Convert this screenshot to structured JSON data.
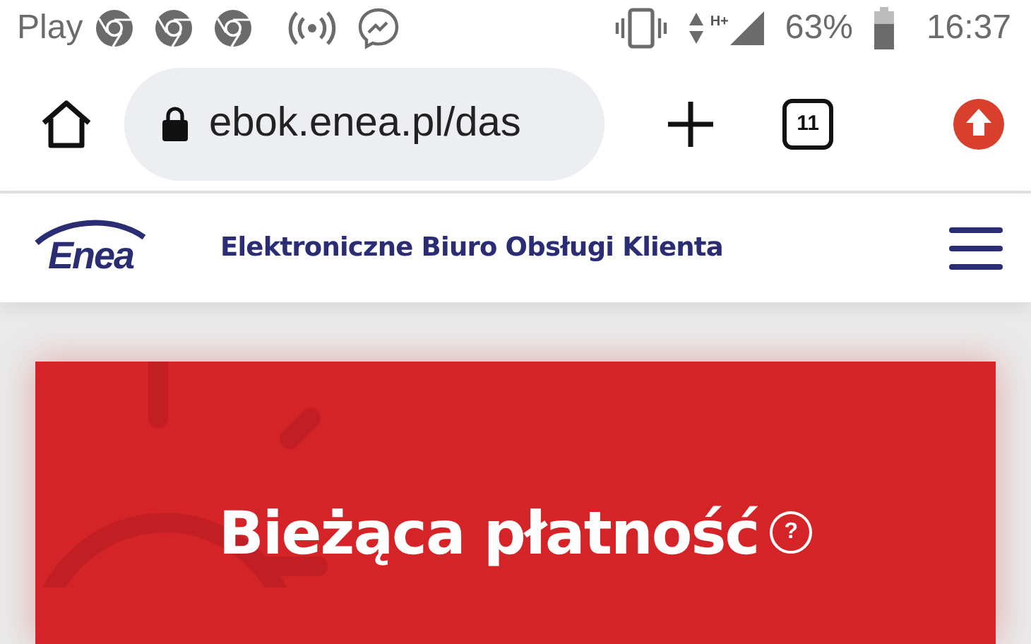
{
  "status_bar": {
    "carrier": "Play",
    "network_type": "H+",
    "battery": "63%",
    "time": "16:37"
  },
  "browser": {
    "url": "ebok.enea.pl/das",
    "tab_count": "11"
  },
  "header": {
    "logo": "Enea",
    "title": "Elektroniczne Biuro Obsługi Klienta"
  },
  "card": {
    "title": "Bieżąca płatność",
    "help": "?"
  }
}
